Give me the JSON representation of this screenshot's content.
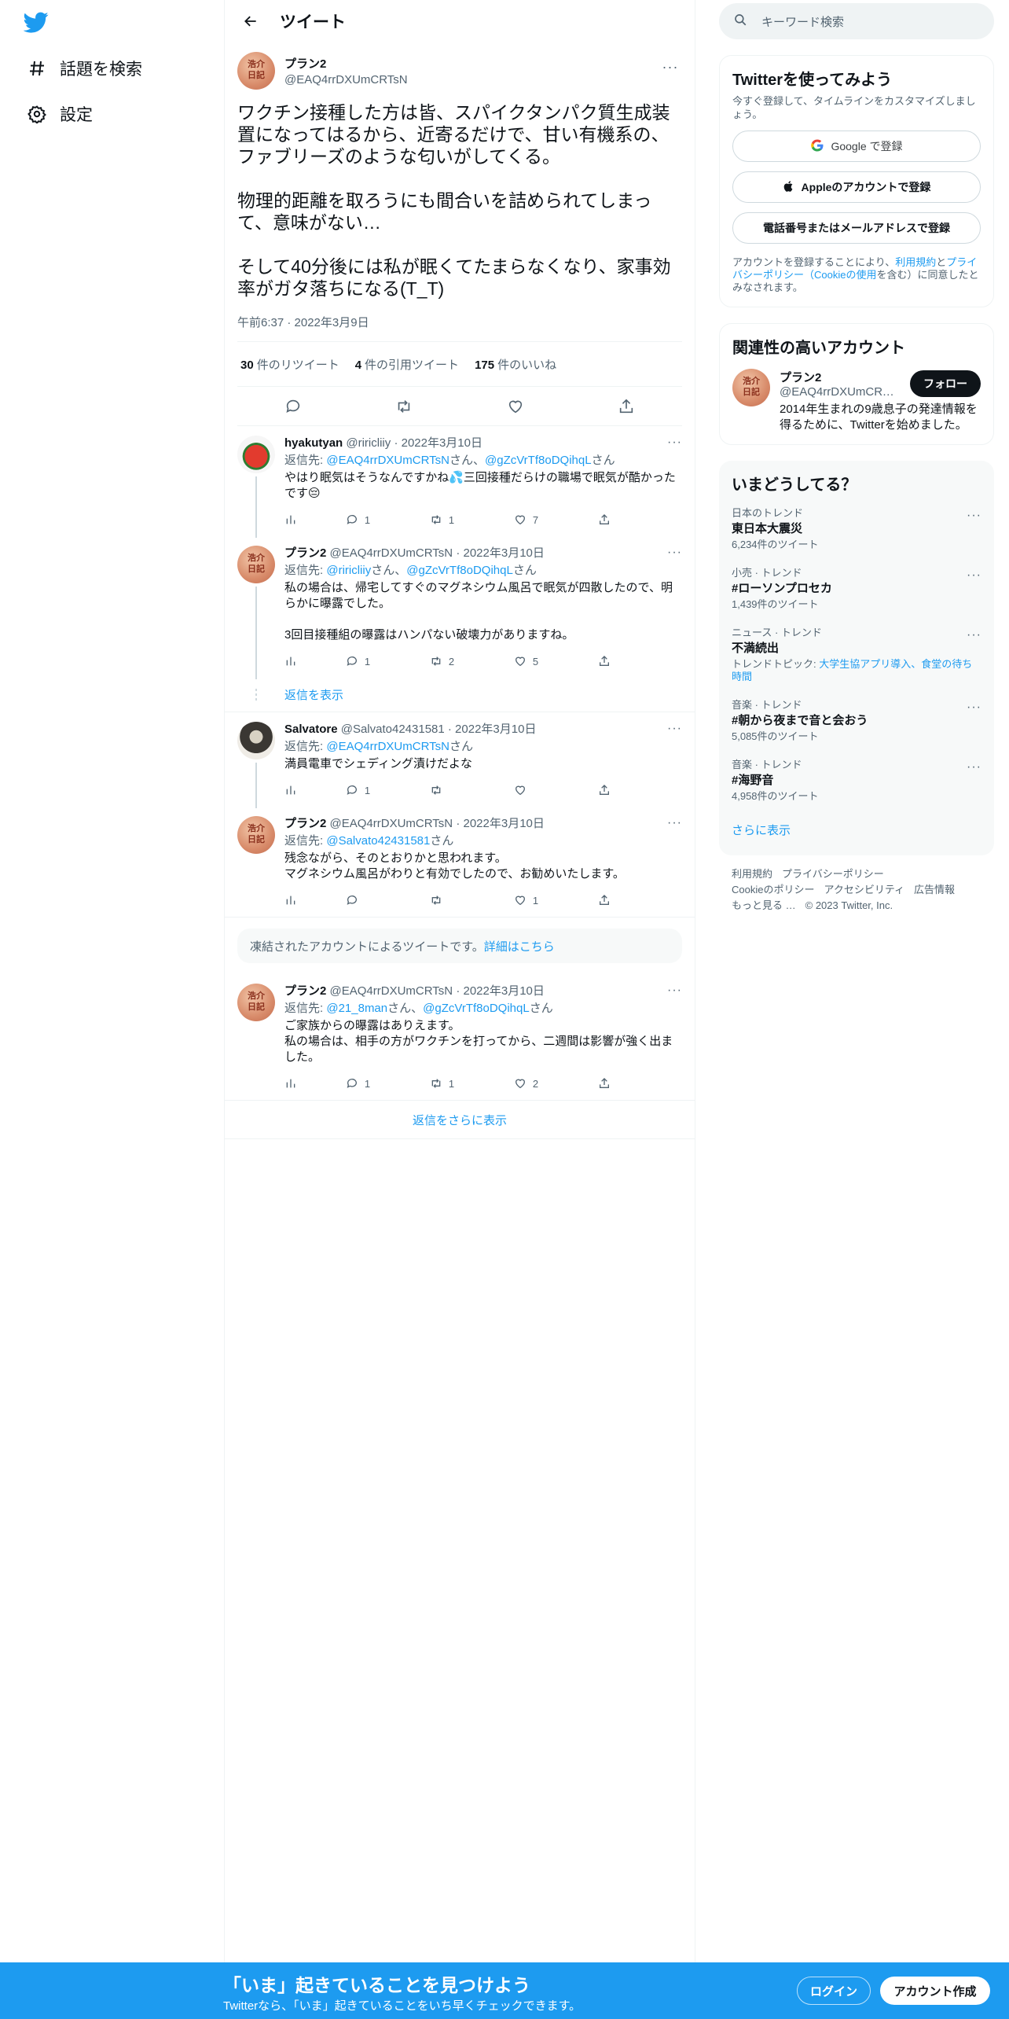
{
  "nav": {
    "explore_label": "話題を検索",
    "settings_label": "設定"
  },
  "header": {
    "title": "ツイート"
  },
  "main_tweet": {
    "name": "プラン2",
    "handle": "@EAQ4rrDXUmCRTsN",
    "body": "ワクチン接種した方は皆、スパイクタンパク質生成装置になってはるから、近寄るだけで、甘い有機系の、ファブリーズのような匂いがしてくる。\n\n物理的距離を取ろうにも間合いを詰められてしまって、意味がない…\n\nそして40分後には私が眠くてたまらなくなり、家事効率がガタ落ちになる(T_T)",
    "time": "午前6:37 · 2022年3月9日",
    "retweets_count": "30",
    "retweets_label": "件のリツイート",
    "quotes_count": "4",
    "quotes_label": "件の引用ツイート",
    "likes_count": "175",
    "likes_label": "件のいいね"
  },
  "replies": [
    {
      "name": "hyakutyan",
      "handle": "@riricliiy",
      "date": "· 2022年3月10日",
      "replyto_prefix": "返信先: ",
      "replyto_1": "@EAQ4rrDXUmCRTsN",
      "replyto_mid": "さん、",
      "replyto_2": "@gZcVrTf8oDQihqL",
      "replyto_suffix": "さん",
      "text": "やはり眠気はそうなんですかね💦三回接種だらけの職場で眠気が酷かったです😔",
      "replies": "1",
      "retweets": "1",
      "likes": "7"
    },
    {
      "name": "プラン2",
      "handle": "@EAQ4rrDXUmCRTsN",
      "date": "· 2022年3月10日",
      "replyto_prefix": "返信先: ",
      "replyto_1": "@riricliiy",
      "replyto_mid": "さん、",
      "replyto_2": "@gZcVrTf8oDQihqL",
      "replyto_suffix": "さん",
      "text": "私の場合は、帰宅してすぐのマグネシウム風呂で眠気が四散したので、明らかに曝露でした。\n\n3回目接種組の曝露はハンパない破壊力がありますね。",
      "replies": "1",
      "retweets": "2",
      "likes": "5"
    },
    {
      "name": "Salvatore",
      "handle": "@Salvato42431581",
      "date": "· 2022年3月10日",
      "replyto_prefix": "返信先: ",
      "replyto_1": "@EAQ4rrDXUmCRTsN",
      "replyto_suffix": "さん",
      "text": "満員電車でシェディング漬けだよな",
      "replies": "1",
      "retweets": "",
      "likes": ""
    },
    {
      "name": "プラン2",
      "handle": "@EAQ4rrDXUmCRTsN",
      "date": "· 2022年3月10日",
      "replyto_prefix": "返信先: ",
      "replyto_1": "@Salvato42431581",
      "replyto_suffix": "さん",
      "text": "残念ながら、そのとおりかと思われます。\nマグネシウム風呂がわりと有効でしたので、お勧めいたします。",
      "replies": "",
      "retweets": "",
      "likes": "1"
    },
    {
      "name": "プラン2",
      "handle": "@EAQ4rrDXUmCRTsN",
      "date": "· 2022年3月10日",
      "replyto_prefix": "返信先: ",
      "replyto_1": "@21_8man",
      "replyto_mid": "さん、",
      "replyto_2": "@gZcVrTf8oDQihqL",
      "replyto_suffix": "さん",
      "text": "ご家族からの曝露はありえます。\n私の場合は、相手の方がワクチンを打ってから、二週間は影響が強く出ました。",
      "replies": "1",
      "retweets": "1",
      "likes": "2"
    }
  ],
  "show_replies_label": "返信を表示",
  "suspended": {
    "text": "凍結されたアカウントによるツイートです。",
    "link": "詳細はこちら"
  },
  "show_more_replies_label": "返信をさらに表示",
  "sidebar": {
    "search_placeholder": "キーワード検索",
    "signup_card": {
      "title": "Twitterを使ってみよう",
      "subtitle": "今すぐ登録して、タイムラインをカスタマイズしましょう。",
      "google_label": "Google で登録",
      "apple_label": "Appleのアカウントで登録",
      "phone_label": "電話番号またはメールアドレスで登録",
      "tos_prefix": "アカウントを登録することにより、",
      "tos_link1": "利用規約",
      "tos_mid1": "と",
      "tos_link2": "プライバシーポリシー（Cookieの使用",
      "tos_suffix": "を含む）に同意したとみなされます。"
    },
    "related": {
      "title": "関連性の高いアカウント",
      "name": "プラン2",
      "handle": "@EAQ4rrDXUmCRTsN",
      "follow_label": "フォロー",
      "bio": "2014年生まれの9歳息子の発達情報を得るために、Twitterを始めました。"
    },
    "trends": {
      "title": "いまどうしてる？",
      "items": [
        {
          "context": "日本のトレンド",
          "name": "東日本大震災",
          "count": "6,234件のツイート",
          "sub_prefix": "",
          "sub_link": ""
        },
        {
          "context": "小売 · トレンド",
          "name": "#ローソンプロセカ",
          "count": "1,439件のツイート",
          "sub_prefix": "",
          "sub_link": ""
        },
        {
          "context": "ニュース · トレンド",
          "name": "不満続出",
          "count": "",
          "sub_prefix": "トレンドトピック: ",
          "sub_link": "大学生協アプリ導入、食堂の待ち時間"
        },
        {
          "context": "音楽 · トレンド",
          "name": "#朝から夜まで音と会おう",
          "count": "5,085件のツイート",
          "sub_prefix": "",
          "sub_link": ""
        },
        {
          "context": "音楽 · トレンド",
          "name": "#海野音",
          "count": "4,958件のツイート",
          "sub_prefix": "",
          "sub_link": ""
        }
      ],
      "show_more": "さらに表示"
    },
    "footer": {
      "terms": "利用規約",
      "privacy": "プライバシーポリシー",
      "cookie": "Cookieのポリシー",
      "accessibility": "アクセシビリティ",
      "ads": "広告情報",
      "more": "もっと見る …",
      "copyright": "© 2023 Twitter, Inc."
    }
  },
  "bottom_bar": {
    "title": "「いま」起きていることを見つけよう",
    "subtitle": "Twitterなら、「いま」起きていることをいち早くチェックできます。",
    "login_label": "ログイン",
    "signup_label": "アカウント作成"
  },
  "colors": {
    "accent": "#1d9bf0",
    "text": "#0f1419",
    "secondary": "#536471",
    "border": "#eff3f4"
  }
}
